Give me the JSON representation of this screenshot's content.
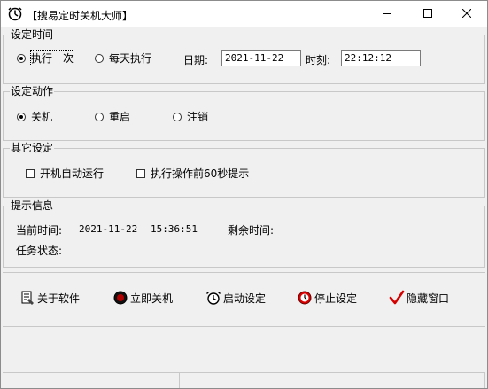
{
  "window": {
    "title": "【搜易定时关机大师】"
  },
  "time_group": {
    "label": "设定时间",
    "options": [
      {
        "label": "执行一次",
        "selected": true
      },
      {
        "label": "每天执行",
        "selected": false
      }
    ],
    "date_label": "日期:",
    "date_value": "2021-11-22",
    "time_label": "时刻:",
    "time_value": "22:12:12"
  },
  "action_group": {
    "label": "设定动作",
    "options": [
      {
        "label": "关机",
        "selected": true
      },
      {
        "label": "重启",
        "selected": false
      },
      {
        "label": "注销",
        "selected": false
      }
    ]
  },
  "other_group": {
    "label": "其它设定",
    "checks": [
      {
        "label": "开机自动运行",
        "checked": false
      },
      {
        "label": "执行操作前60秒提示",
        "checked": false
      }
    ]
  },
  "info_group": {
    "label": "提示信息",
    "current_time_label": "当前时间:",
    "current_date": "2021-11-22",
    "current_clock": "15:36:51",
    "remaining_label": "剩余时间:",
    "remaining_value": "",
    "task_status_label": "任务状态:",
    "task_status_value": ""
  },
  "toolbar": {
    "about": "关于软件",
    "shutdown_now": "立即关机",
    "start": "启动设定",
    "stop": "停止设定",
    "hide": "隐藏窗口"
  },
  "colors": {
    "stop_red": "#d80000",
    "check_red": "#d40000",
    "window_bg": "#f0f0f0"
  }
}
